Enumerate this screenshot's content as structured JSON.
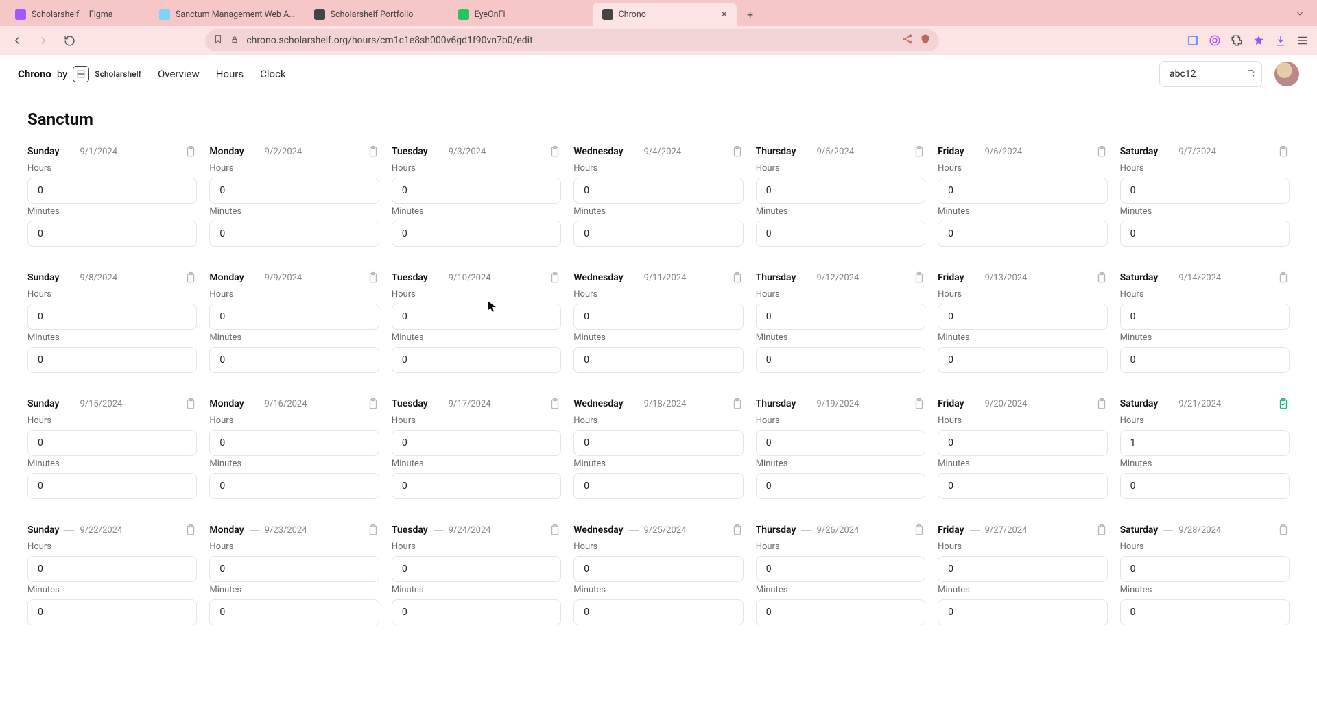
{
  "browser": {
    "tabs": [
      {
        "label": "Scholarshelf – Figma",
        "favicon_color": "#a259ff"
      },
      {
        "label": "Sanctum Management Web A…",
        "favicon_color": "#7dd3fc"
      },
      {
        "label": "Scholarshelf Portfolio",
        "favicon_color": "#444"
      },
      {
        "label": "EyeOnFi",
        "favicon_color": "#22c55e"
      },
      {
        "label": "Chrono",
        "favicon_color": "#444",
        "active": true
      }
    ],
    "url": "chrono.scholarshelf.org/hours/cm1c1e8sh000v6gd1f90vn7b0/edit"
  },
  "header": {
    "brand_strong": "Chrono",
    "brand_by": "by",
    "brand_sub": "Scholarshelf",
    "nav": [
      "Overview",
      "Hours",
      "Clock"
    ],
    "select_value": "abc12"
  },
  "page": {
    "title": "Sanctum",
    "labels": {
      "hours": "Hours",
      "minutes": "Minutes"
    },
    "weeks": [
      [
        {
          "name": "Sunday",
          "date": "9/1/2024",
          "hours": "0",
          "minutes": "0"
        },
        {
          "name": "Monday",
          "date": "9/2/2024",
          "hours": "0",
          "minutes": "0"
        },
        {
          "name": "Tuesday",
          "date": "9/3/2024",
          "hours": "0",
          "minutes": "0"
        },
        {
          "name": "Wednesday",
          "date": "9/4/2024",
          "hours": "0",
          "minutes": "0"
        },
        {
          "name": "Thursday",
          "date": "9/5/2024",
          "hours": "0",
          "minutes": "0"
        },
        {
          "name": "Friday",
          "date": "9/6/2024",
          "hours": "0",
          "minutes": "0"
        },
        {
          "name": "Saturday",
          "date": "9/7/2024",
          "hours": "0",
          "minutes": "0"
        }
      ],
      [
        {
          "name": "Sunday",
          "date": "9/8/2024",
          "hours": "0",
          "minutes": "0"
        },
        {
          "name": "Monday",
          "date": "9/9/2024",
          "hours": "0",
          "minutes": "0"
        },
        {
          "name": "Tuesday",
          "date": "9/10/2024",
          "hours": "0",
          "minutes": "0"
        },
        {
          "name": "Wednesday",
          "date": "9/11/2024",
          "hours": "0",
          "minutes": "0"
        },
        {
          "name": "Thursday",
          "date": "9/12/2024",
          "hours": "0",
          "minutes": "0"
        },
        {
          "name": "Friday",
          "date": "9/13/2024",
          "hours": "0",
          "minutes": "0"
        },
        {
          "name": "Saturday",
          "date": "9/14/2024",
          "hours": "0",
          "minutes": "0"
        }
      ],
      [
        {
          "name": "Sunday",
          "date": "9/15/2024",
          "hours": "0",
          "minutes": "0"
        },
        {
          "name": "Monday",
          "date": "9/16/2024",
          "hours": "0",
          "minutes": "0"
        },
        {
          "name": "Tuesday",
          "date": "9/17/2024",
          "hours": "0",
          "minutes": "0"
        },
        {
          "name": "Wednesday",
          "date": "9/18/2024",
          "hours": "0",
          "minutes": "0"
        },
        {
          "name": "Thursday",
          "date": "9/19/2024",
          "hours": "0",
          "minutes": "0"
        },
        {
          "name": "Friday",
          "date": "9/20/2024",
          "hours": "0",
          "minutes": "0"
        },
        {
          "name": "Saturday",
          "date": "9/21/2024",
          "hours": "1",
          "minutes": "0",
          "paste_active": true
        }
      ],
      [
        {
          "name": "Sunday",
          "date": "9/22/2024",
          "hours": "0",
          "minutes": "0"
        },
        {
          "name": "Monday",
          "date": "9/23/2024",
          "hours": "0",
          "minutes": "0"
        },
        {
          "name": "Tuesday",
          "date": "9/24/2024",
          "hours": "0",
          "minutes": "0"
        },
        {
          "name": "Wednesday",
          "date": "9/25/2024",
          "hours": "0",
          "minutes": "0"
        },
        {
          "name": "Thursday",
          "date": "9/26/2024",
          "hours": "0",
          "minutes": "0"
        },
        {
          "name": "Friday",
          "date": "9/27/2024",
          "hours": "0",
          "minutes": "0"
        },
        {
          "name": "Saturday",
          "date": "9/28/2024",
          "hours": "0",
          "minutes": "0"
        }
      ]
    ]
  }
}
